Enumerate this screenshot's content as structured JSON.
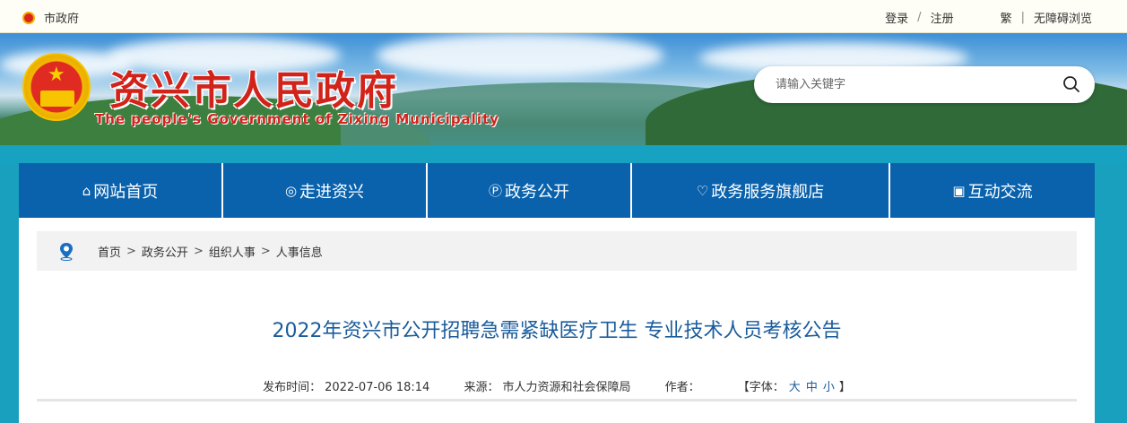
{
  "topbar": {
    "home_label": "市政府",
    "login": "登录",
    "sep": "/",
    "register": "注册",
    "traditional": "繁",
    "sep2": "|",
    "accessible": "无障碍浏览"
  },
  "banner": {
    "title": "资兴市人民政府",
    "subtitle": "The people's Government of Zixing Municipality"
  },
  "search": {
    "placeholder": "请输入关键字",
    "icon": "search-icon"
  },
  "nav": {
    "items": [
      {
        "label": "网站首页",
        "icon": "home-icon"
      },
      {
        "label": "走进资兴",
        "icon": "target-icon"
      },
      {
        "label": "政务公开",
        "icon": "p-circle-icon"
      },
      {
        "label": "政务服务旗舰店",
        "icon": "heart-circle-icon"
      },
      {
        "label": "互动交流",
        "icon": "chat-icon"
      }
    ]
  },
  "breadcrumb": {
    "icon": "location-pin-icon",
    "items": [
      "首页",
      "政务公开",
      "组织人事",
      "人事信息"
    ],
    "separator": ">"
  },
  "article": {
    "title": "2022年资兴市公开招聘急需紧缺医疗卫生 专业技术人员考核公告",
    "publish_label": "发布时间：",
    "publish_time": "2022-07-06 18:14",
    "source_label": "来源：",
    "source": "市人力资源和社会保障局",
    "author_label": "作者：",
    "author": "",
    "font_label_open": "【字体：",
    "font_large": "大",
    "font_medium": "中",
    "font_small": "小",
    "font_label_close": "】"
  },
  "colors": {
    "nav_bg": "#0a62ad",
    "title_red": "#d2231b",
    "article_title": "#1a5c9c"
  }
}
